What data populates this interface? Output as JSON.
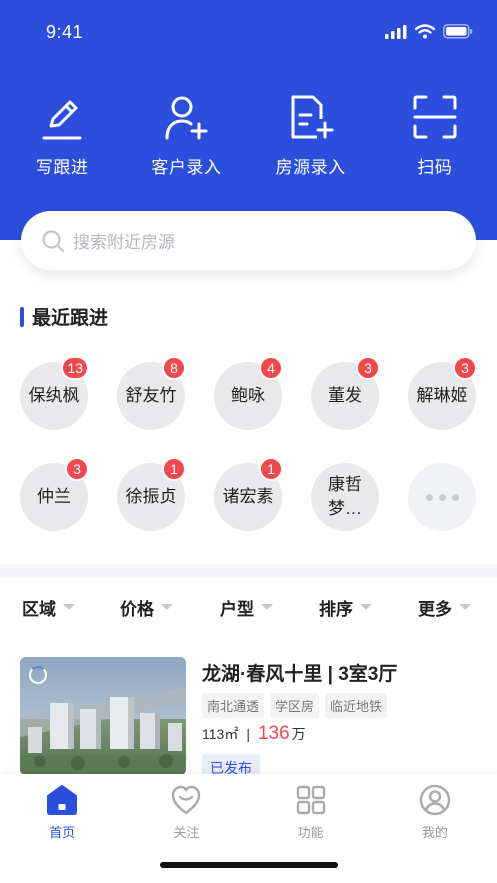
{
  "status_bar": {
    "time": "9:41"
  },
  "quick_actions": [
    {
      "label": "写跟进",
      "icon": "pen-icon"
    },
    {
      "label": "客户录入",
      "icon": "add-user-icon"
    },
    {
      "label": "房源录入",
      "icon": "add-document-icon"
    },
    {
      "label": "扫码",
      "icon": "scan-icon"
    }
  ],
  "search": {
    "placeholder": "搜索附近房源"
  },
  "recent": {
    "title": "最近跟进",
    "contacts": [
      {
        "name": "保纨枫",
        "badge": "13"
      },
      {
        "name": "舒友竹",
        "badge": "8"
      },
      {
        "name": "鲍咏",
        "badge": "4"
      },
      {
        "name": "董发",
        "badge": "3"
      },
      {
        "name": "解琳姬",
        "badge": "3"
      },
      {
        "name": "仲兰",
        "badge": "3"
      },
      {
        "name": "徐振贞",
        "badge": "1"
      },
      {
        "name": "诸宏素",
        "badge": "1"
      },
      {
        "name": "康哲梦…",
        "badge": ""
      }
    ]
  },
  "filters": [
    "区域",
    "价格",
    "户型",
    "排序",
    "更多"
  ],
  "listing": {
    "title": "龙湖·春风十里 | 3室3厅",
    "tags": [
      "南北通透",
      "学区房",
      "临近地铁"
    ],
    "area": "113㎡",
    "separator": "|",
    "price": "136",
    "price_unit": "万",
    "status": "已发布"
  },
  "tabbar": {
    "tabs": [
      {
        "label": "首页",
        "icon": "home-icon",
        "active": true
      },
      {
        "label": "关注",
        "icon": "heart-icon",
        "active": false
      },
      {
        "label": "功能",
        "icon": "grid-icon",
        "active": false
      },
      {
        "label": "我的",
        "icon": "profile-icon",
        "active": false
      }
    ]
  },
  "colors": {
    "brand": "#2b4fdc",
    "badge": "#f0484f",
    "price": "#f0484f"
  }
}
